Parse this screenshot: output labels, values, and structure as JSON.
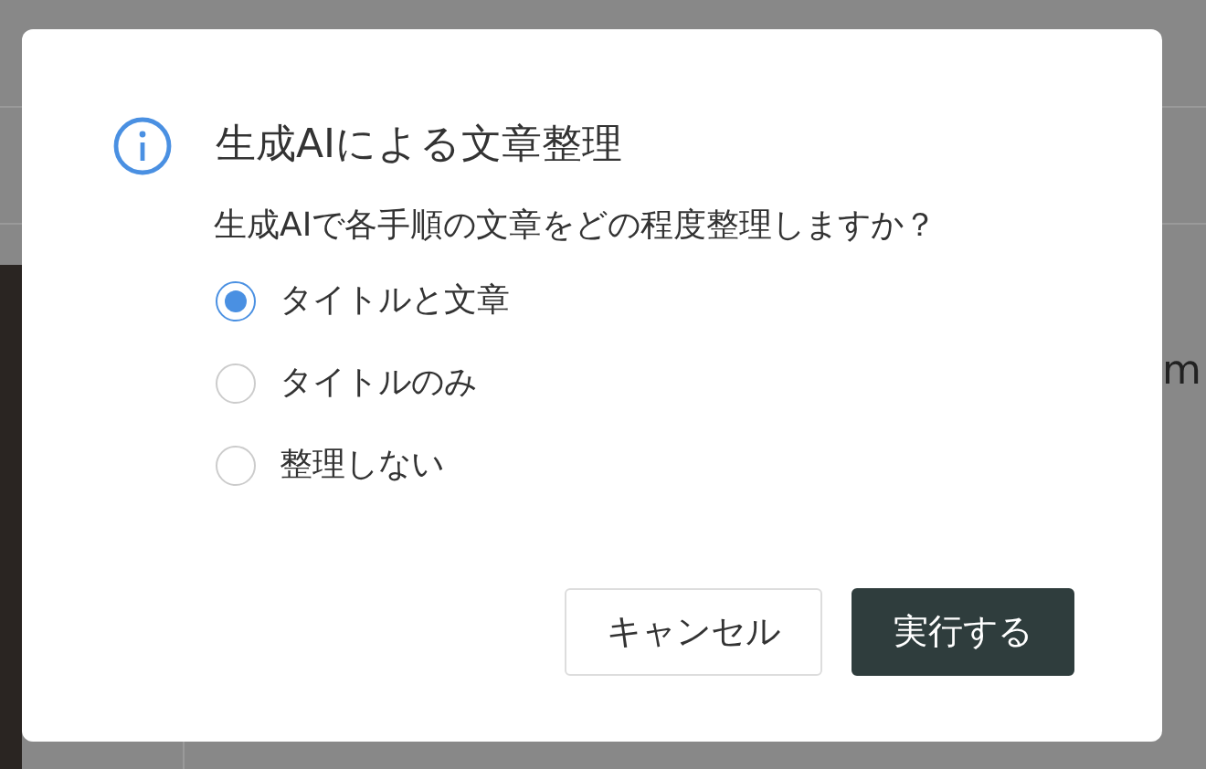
{
  "background": {
    "side_text": "m"
  },
  "dialog": {
    "title": "生成AIによる文章整理",
    "message": "生成AIで各手順の文章をどの程度整理しますか？",
    "options": [
      {
        "label": "タイトルと文章",
        "selected": true
      },
      {
        "label": "タイトルのみ",
        "selected": false
      },
      {
        "label": "整理しない",
        "selected": false
      }
    ],
    "buttons": [
      {
        "label": "キャンセル",
        "kind": "secondary"
      },
      {
        "label": "実行する",
        "kind": "primary"
      }
    ]
  }
}
